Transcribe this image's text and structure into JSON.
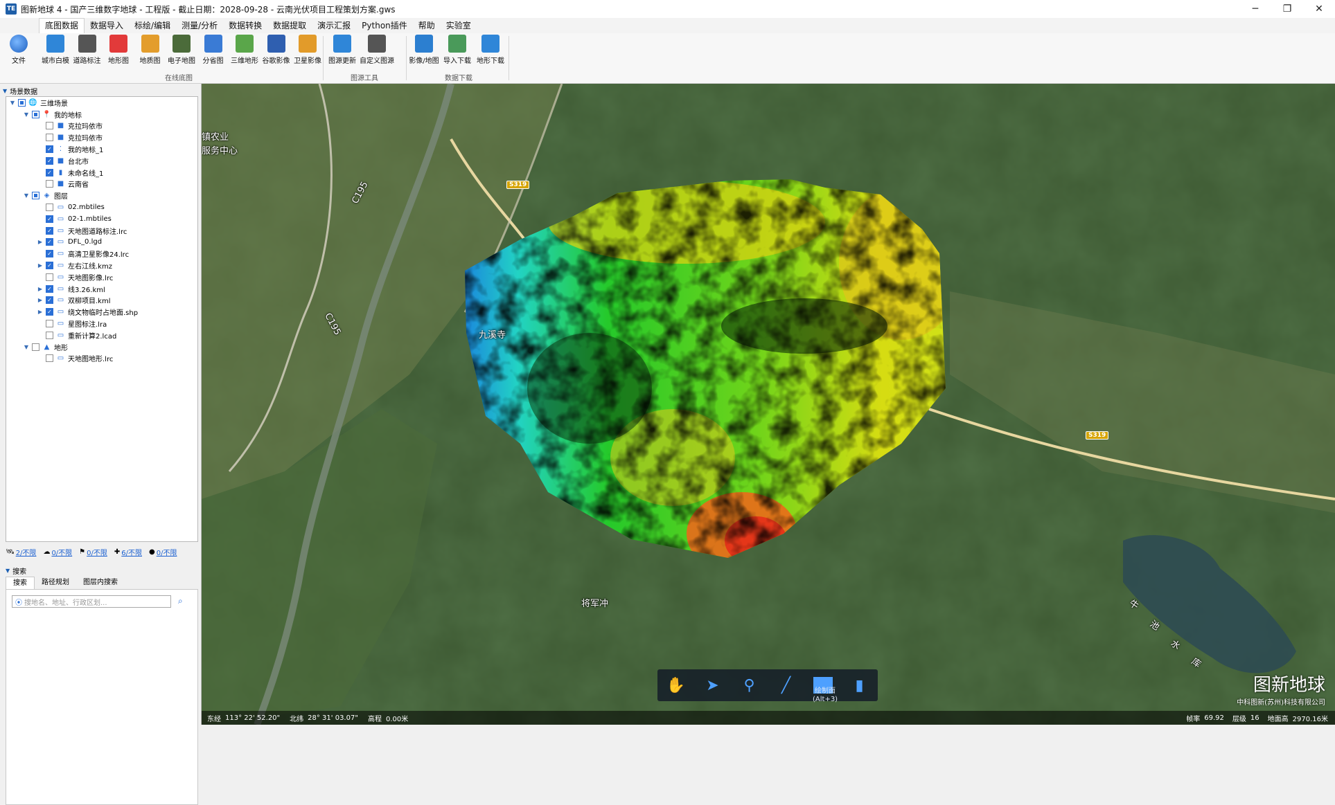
{
  "window": {
    "title": "图新地球 4 - 国产三维数字地球 - 工程版 - 截止日期：2028-09-28 - 云南光伏项目工程策划方案.gws",
    "app_icon_text": "TE",
    "min": "─",
    "max": "❐",
    "close": "✕"
  },
  "menu": {
    "tabs": [
      "底图数据",
      "数据导入",
      "标绘/编辑",
      "测量/分析",
      "数据转换",
      "数据提取",
      "演示汇报",
      "Python插件",
      "帮助",
      "实验室"
    ],
    "active": "底图数据"
  },
  "ribbon": {
    "file_label": "文件",
    "online": [
      "城市白模",
      "道路标注",
      "地形图",
      "地质图",
      "电子地图",
      "分省图",
      "三维地形",
      "谷歌影像",
      "卫星影像"
    ],
    "tools": [
      "图源更新",
      "自定义图源"
    ],
    "download": [
      "影像/地图",
      "导入下载",
      "地形下载"
    ],
    "groups": {
      "online": "在线底图",
      "tools": "图源工具",
      "download": "数据下载"
    }
  },
  "panel": {
    "section_title": "场景数据",
    "tree": [
      {
        "level": 0,
        "exp": "▼",
        "check": "part",
        "icon": "globe",
        "label": "三维场景"
      },
      {
        "level": 1,
        "exp": "▼",
        "check": "part",
        "icon": "pin",
        "label": "我的地标"
      },
      {
        "level": 2,
        "exp": "",
        "check": "off",
        "icon": "sq",
        "label": "克拉玛依市"
      },
      {
        "level": 2,
        "exp": "",
        "check": "off",
        "icon": "sq",
        "label": "克拉玛依市"
      },
      {
        "level": 2,
        "exp": "",
        "check": "on",
        "icon": "pts",
        "label": "我的地标_1"
      },
      {
        "level": 2,
        "exp": "",
        "check": "on",
        "icon": "sq",
        "label": "台北市"
      },
      {
        "level": 2,
        "exp": "",
        "check": "on",
        "icon": "bars",
        "label": "未命名线_1"
      },
      {
        "level": 2,
        "exp": "",
        "check": "off",
        "icon": "sq",
        "label": "云南省"
      },
      {
        "level": 1,
        "exp": "▼",
        "check": "part",
        "icon": "layers",
        "label": "图层"
      },
      {
        "level": 2,
        "exp": "",
        "check": "off",
        "icon": "mon",
        "label": "02.mbtiles"
      },
      {
        "level": 2,
        "exp": "",
        "check": "on",
        "icon": "mon",
        "label": "02-1.mbtiles"
      },
      {
        "level": 2,
        "exp": "",
        "check": "on",
        "icon": "mon",
        "label": "天地图道路标注.lrc"
      },
      {
        "level": 2,
        "exp": "▶",
        "check": "on",
        "icon": "mon",
        "label": "DFL_0.lgd"
      },
      {
        "level": 2,
        "exp": "",
        "check": "on",
        "icon": "mon",
        "label": "高清卫星影像24.lrc"
      },
      {
        "level": 2,
        "exp": "▶",
        "check": "on",
        "icon": "mon",
        "label": "左右江线.kmz"
      },
      {
        "level": 2,
        "exp": "",
        "check": "off",
        "icon": "mon",
        "label": "天地图影像.lrc"
      },
      {
        "level": 2,
        "exp": "▶",
        "check": "on",
        "icon": "mon",
        "label": "线3.26.kml"
      },
      {
        "level": 2,
        "exp": "▶",
        "check": "on",
        "icon": "mon",
        "label": "双柳项目.kml"
      },
      {
        "level": 2,
        "exp": "▶",
        "check": "on",
        "icon": "mon",
        "label": "绕文物临时占地面.shp"
      },
      {
        "level": 2,
        "exp": "",
        "check": "off",
        "icon": "mon",
        "label": "星图标注.lra"
      },
      {
        "level": 2,
        "exp": "",
        "check": "off",
        "icon": "mon",
        "label": "重新计算2.lcad"
      },
      {
        "level": 1,
        "exp": "▼",
        "check": "off",
        "icon": "terrain",
        "label": "地形"
      },
      {
        "level": 2,
        "exp": "",
        "check": "off",
        "icon": "mon",
        "label": "天地图地形.lrc"
      }
    ],
    "stats": [
      "2/不限",
      "0/不限",
      "0/不限",
      "6/不限",
      "0/不限"
    ],
    "search_title": "搜索",
    "search_tabs": [
      "搜索",
      "路径规划",
      "图层内搜索"
    ],
    "search_placeholder": "搜地名、地址、行政区划..."
  },
  "map": {
    "labels": {
      "town1": "镇农业",
      "town2": "服务中心",
      "c195a": "C195",
      "c195b": "C195",
      "s319a": "S319",
      "s319b": "S319",
      "jiuxi": "九溪寺",
      "jiangjun": "将军冲"
    },
    "lake_labels": [
      "牛",
      "池",
      "水",
      "库"
    ],
    "drawtool_tip_1": "绘制面",
    "drawtool_tip_2": "(Alt+3)",
    "status": {
      "lon_label": "东经",
      "lon_value": "113° 22' 52.20\"",
      "lat_label": "北纬",
      "lat_value": "28° 31' 03.07\"",
      "elev_label": "高程",
      "elev_value": "0.00米",
      "fps_label": "帧率",
      "fps_value": "69.92",
      "level_label": "层级",
      "level_value": "16",
      "alt_label": "地面高",
      "alt_value": "2970.16米"
    },
    "brand_big": "图新地球",
    "brand_small": "中科图新(苏州)科技有限公司"
  }
}
